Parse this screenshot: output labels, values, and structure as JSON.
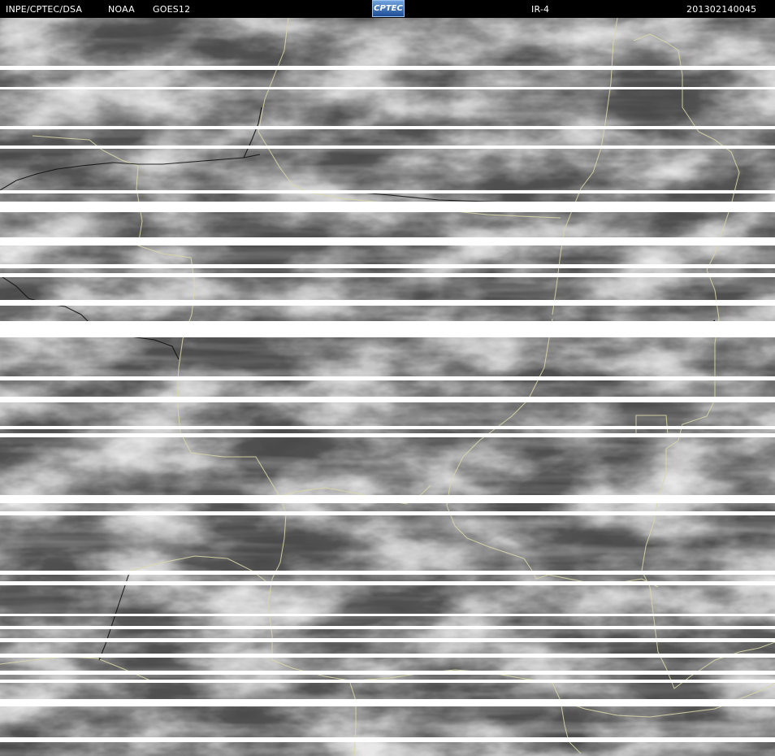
{
  "header": {
    "source": "INPE/CPTEC/DSA",
    "agency": "NOAA",
    "satellite": "GOES12",
    "logo_text": "CPTEC",
    "channel": "IR-4",
    "timestamp": "201302140045"
  },
  "colors": {
    "header_bg": "#000000",
    "header_text": "#ffffff",
    "cloud_base": "#4a4a4a",
    "cloud_top": "#e8e8e8",
    "state_border": "#d8d8a8",
    "country_border": "#000000",
    "scanline_gap": "#ffffff"
  }
}
